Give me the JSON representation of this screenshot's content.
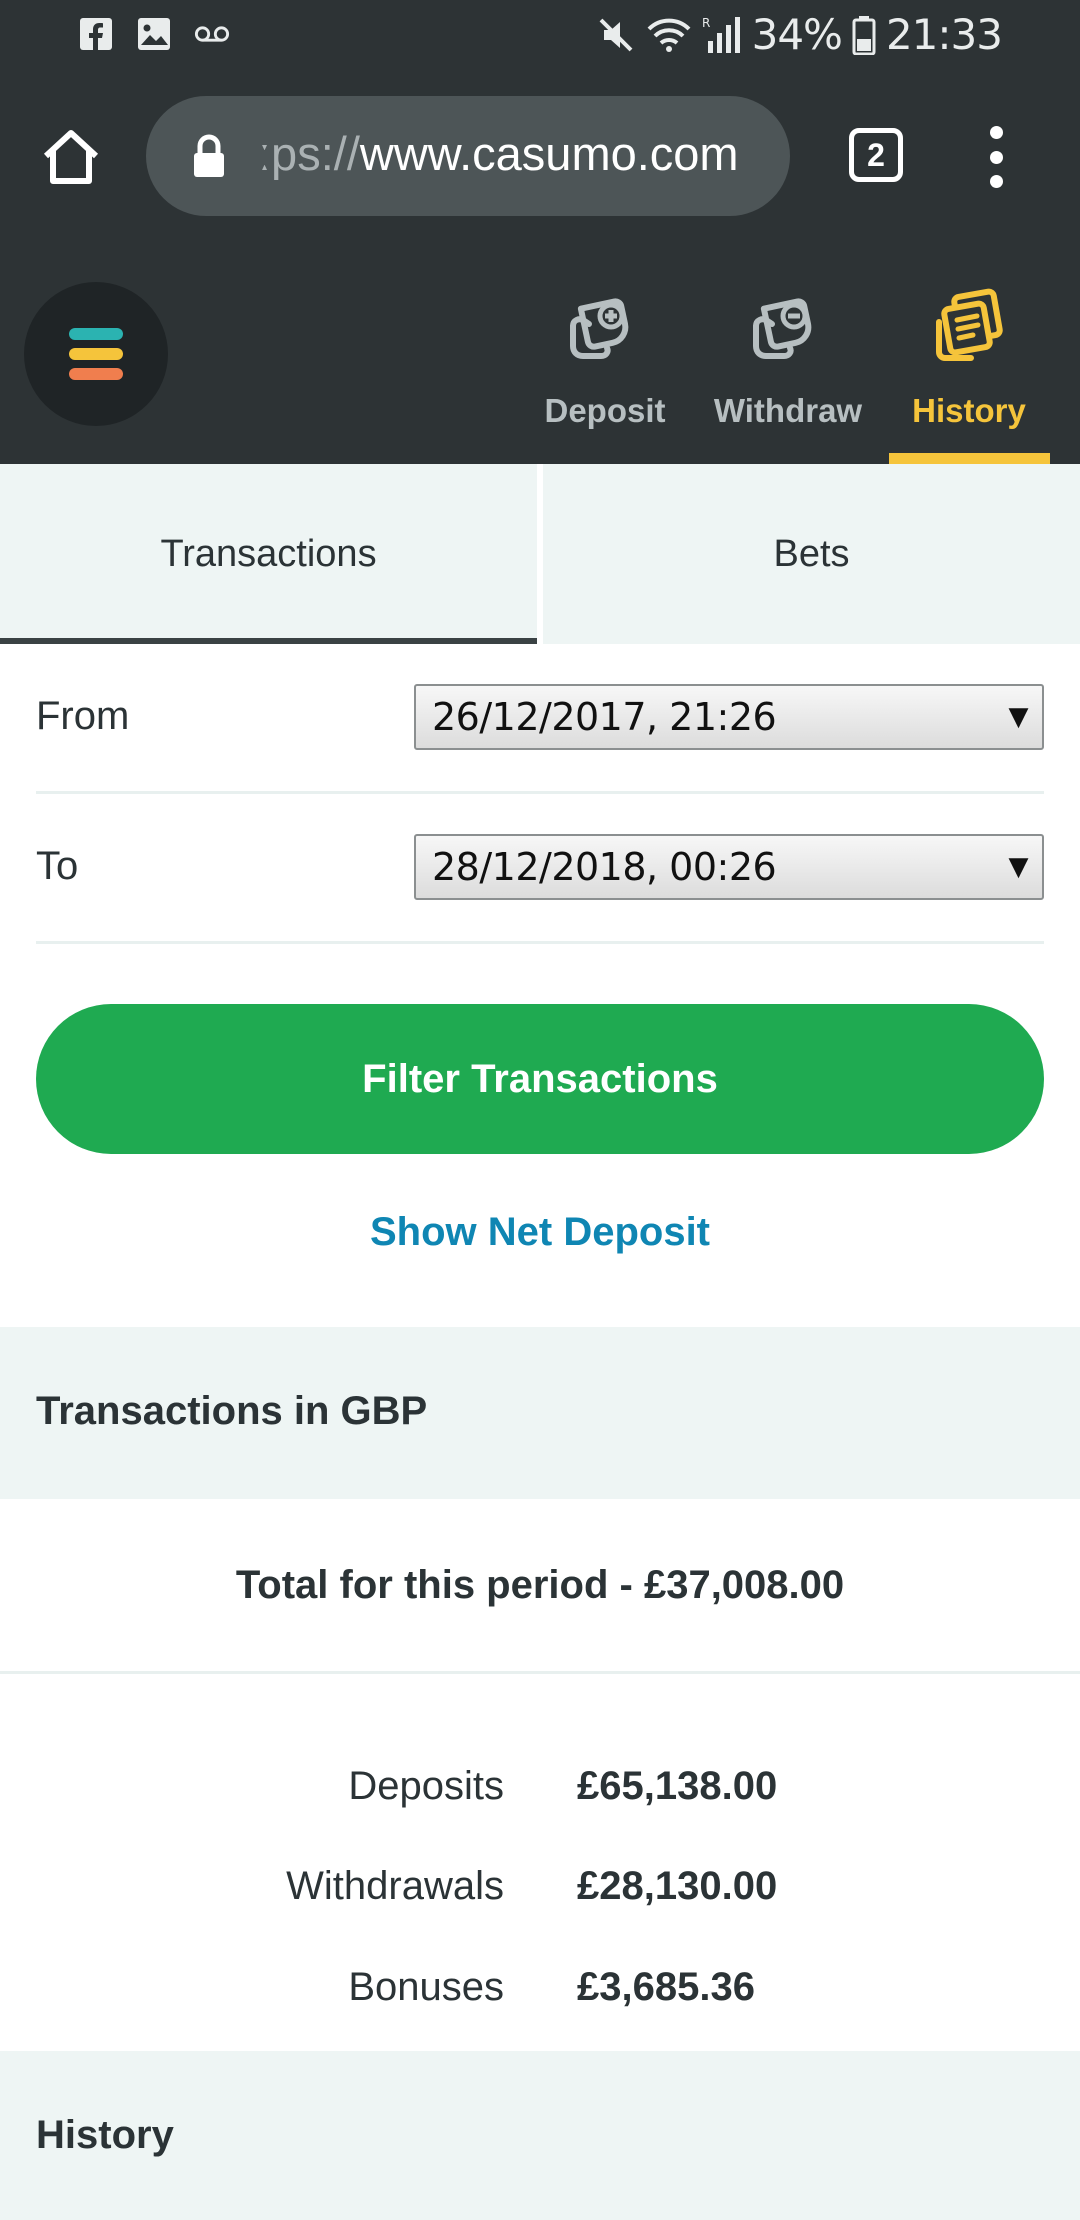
{
  "status_bar": {
    "left_icons": [
      "facebook-icon",
      "image-icon",
      "voicemail-icon"
    ],
    "battery": "34%",
    "time": "21:33"
  },
  "browser": {
    "url_faded": "ːps://",
    "url_main": "www.casumo.com",
    "tab_count": "2"
  },
  "app_nav": {
    "items": [
      {
        "label": "Deposit",
        "icon": "deposit-icon"
      },
      {
        "label": "Withdraw",
        "icon": "withdraw-icon"
      },
      {
        "label": "History",
        "icon": "history-icon",
        "active": true
      }
    ],
    "accent_color": "#f5c43b"
  },
  "sub_tabs": {
    "transactions": "Transactions",
    "bets": "Bets"
  },
  "filter": {
    "from_label": "From",
    "from_value": "26/12/2017, 21:26",
    "to_label": "To",
    "to_value": "28/12/2018, 00:26",
    "filter_button": "Filter Transactions",
    "net_deposit_link": "Show Net Deposit",
    "button_color": "#1faa51",
    "link_color": "#0f86b3"
  },
  "summary": {
    "heading": "Transactions in GBP",
    "total": "Total for this period - £37,008.00",
    "rows": [
      {
        "label": "Deposits",
        "value": "£65,138.00"
      },
      {
        "label": "Withdrawals",
        "value": "£28,130.00"
      },
      {
        "label": "Bonuses",
        "value": "£3,685.36"
      }
    ]
  },
  "history": {
    "heading": "History"
  }
}
